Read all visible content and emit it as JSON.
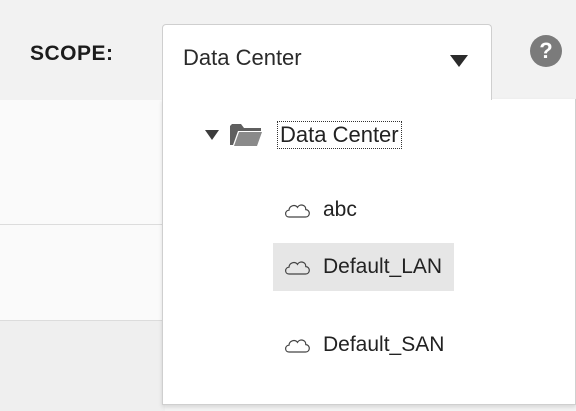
{
  "scope": {
    "label": "SCOPE:",
    "selected_value": "Data Center"
  },
  "help": {
    "glyph": "?"
  },
  "tree": {
    "root": {
      "label": "Data Center",
      "expanded": true,
      "icon": "folder-icon"
    },
    "children": [
      {
        "label": "abc",
        "icon": "cloud-icon",
        "selected": false
      },
      {
        "label": "Default_LAN",
        "icon": "cloud-icon",
        "selected": true
      },
      {
        "label": "Default_SAN",
        "icon": "cloud-icon",
        "selected": false
      }
    ]
  },
  "colors": {
    "selected_bg": "#e6e6e6",
    "help_icon": "#7b7b7b"
  }
}
